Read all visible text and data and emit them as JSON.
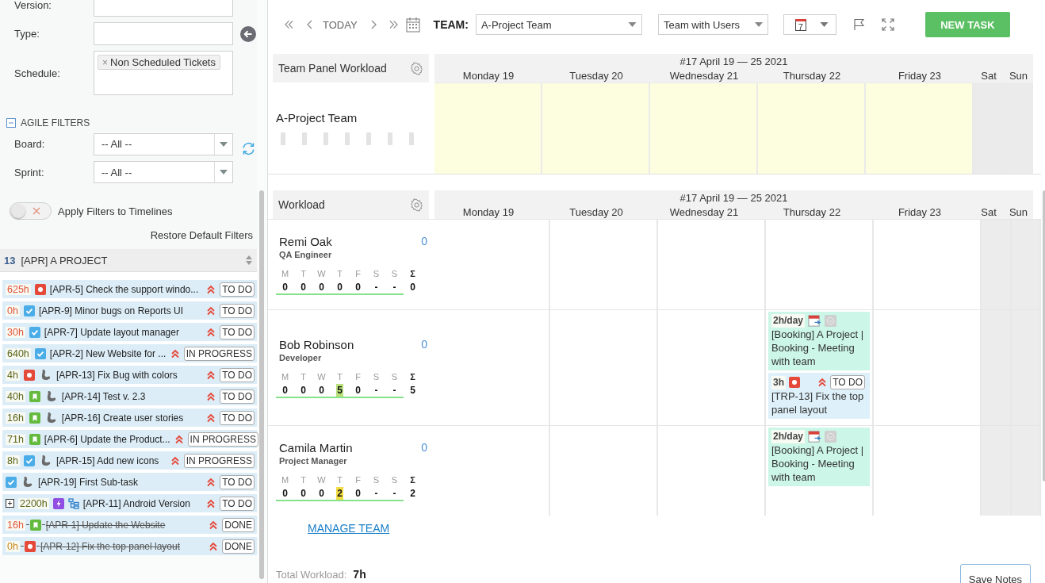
{
  "filters": {
    "fields": [
      {
        "label": "Version:",
        "kind": "text"
      },
      {
        "label": "Type:",
        "kind": "text"
      },
      {
        "label": "Schedule:",
        "kind": "tags",
        "tags": [
          {
            "remove": "×",
            "label": "Non Scheduled Tickets"
          }
        ]
      }
    ],
    "agile": {
      "title": "AGILE FILTERS",
      "expanded": true,
      "selects": [
        {
          "label": "Board:",
          "value": "-- All --"
        },
        {
          "label": "Sprint:",
          "value": "-- All --"
        }
      ]
    },
    "apply_toggle": {
      "label": "Apply Filters to Timelines",
      "on": false
    },
    "restore": "Restore Default Filters"
  },
  "project": {
    "count": "13",
    "name": "[APR] A PROJECT"
  },
  "tasks": [
    {
      "hours": "625h",
      "color": "#e2573a",
      "kind": "bug",
      "expandable": false,
      "assignee": false,
      "hierarchy": false,
      "title": "[APR-5] Check the support windo...",
      "status": "TO DO",
      "done": false
    },
    {
      "hours": "0h",
      "color": "#e2573a",
      "kind": "task",
      "expandable": false,
      "assignee": false,
      "hierarchy": false,
      "title": "[APR-9] Minor bugs on Reports UI",
      "status": "TO DO",
      "done": false
    },
    {
      "hours": "30h",
      "color": "#e2573a",
      "kind": "task",
      "expandable": false,
      "assignee": false,
      "hierarchy": false,
      "title": "[APR-7] Update layout manager",
      "status": "TO DO",
      "done": false
    },
    {
      "hours": "640h",
      "color": "#5c6418",
      "kind": "task",
      "expandable": false,
      "assignee": false,
      "hierarchy": false,
      "title": "[APR-2] New Website for ...",
      "status": "IN PROGRESS",
      "done": false
    },
    {
      "hours": "4h",
      "color": "#5c6418",
      "kind": "bug",
      "expandable": false,
      "assignee": true,
      "hierarchy": false,
      "title": "[APR-13] Fix Bug with colors",
      "status": "TO DO",
      "done": false
    },
    {
      "hours": "40h",
      "color": "#5c6418",
      "kind": "story",
      "expandable": false,
      "assignee": true,
      "hierarchy": false,
      "title": "[APR-14] Test v. 2.3",
      "status": "TO DO",
      "done": false
    },
    {
      "hours": "16h",
      "color": "#5c6418",
      "kind": "story",
      "expandable": false,
      "assignee": true,
      "hierarchy": false,
      "title": "[APR-16] Create user stories",
      "status": "TO DO",
      "done": false
    },
    {
      "hours": "71h",
      "color": "#5c6418",
      "kind": "story",
      "expandable": false,
      "assignee": false,
      "hierarchy": false,
      "title": "[APR-6] Update the Product...",
      "status": "IN PROGRESS",
      "done": false
    },
    {
      "hours": "8h",
      "color": "#5c6418",
      "kind": "task",
      "expandable": false,
      "assignee": true,
      "hierarchy": false,
      "title": "[APR-15] Add new icons",
      "status": "IN PROGRESS",
      "done": false
    },
    {
      "kind": "task",
      "expandable": false,
      "assignee": true,
      "hierarchy": false,
      "title": "[APR-19] First Sub-task",
      "status": "TO DO",
      "done": false
    },
    {
      "hours": "2200h",
      "color": "#5c6418",
      "kind": "epic",
      "expandable": true,
      "assignee": false,
      "hierarchy": true,
      "title": "[APR-11] Android Version",
      "status": "TO DO",
      "done": false
    },
    {
      "hours": "16h",
      "color": "#e2573a",
      "kind": "story",
      "expandable": false,
      "assignee": false,
      "hierarchy": false,
      "title": "[APR-1] Update the Website",
      "status": "DONE",
      "done": true
    },
    {
      "hours": "0h",
      "color": "#c98a1e",
      "kind": "bug",
      "expandable": false,
      "assignee": false,
      "hierarchy": false,
      "title": "[APR-12] Fix the top panel layout",
      "status": "DONE",
      "done": true
    }
  ],
  "toolbar": {
    "today": "TODAY",
    "team_label": "TEAM:",
    "team": "A-Project Team",
    "view": "Team with Users",
    "date_day": "7",
    "new_task": "NEW TASK"
  },
  "team_panel": {
    "title": "Team Panel Workload",
    "week": "#17 April 19 — 25 2021",
    "team": "A-Project Team",
    "days": [
      {
        "label": "Monday 19",
        "weekend": false
      },
      {
        "label": "Tuesday 20",
        "weekend": false
      },
      {
        "label": "Wednesday 21",
        "weekend": false
      },
      {
        "label": "Thursday 22",
        "weekend": false
      },
      {
        "label": "Friday 23",
        "weekend": false
      },
      {
        "label": "Sat",
        "weekend": true
      },
      {
        "label": "Sun",
        "weekend": true
      }
    ]
  },
  "workload": {
    "title": "Workload",
    "week": "#17 April 19 — 25 2021",
    "days": [
      "Monday 19",
      "Tuesday 20",
      "Wednesday 21",
      "Thursday 22",
      "Friday 23",
      "Sat",
      "Sun"
    ],
    "people": [
      {
        "name": "Remi Oak",
        "role": "QA Engineer",
        "count": "0",
        "total_label": "Σ",
        "total": "0",
        "days": [
          {
            "letter": "M",
            "value": "0"
          },
          {
            "letter": "T",
            "value": "0"
          },
          {
            "letter": "W",
            "value": "0"
          },
          {
            "letter": "T",
            "value": "0"
          },
          {
            "letter": "F",
            "value": "0"
          },
          {
            "letter": "S",
            "value": "-"
          },
          {
            "letter": "S",
            "value": "-"
          }
        ],
        "cells": [
          {
            "weekend": false
          },
          {
            "weekend": false
          },
          {
            "weekend": false
          },
          {
            "weekend": false
          },
          {
            "weekend": false
          },
          {
            "weekend": true
          },
          {
            "weekend": true
          }
        ]
      },
      {
        "name": "Bob Robinson",
        "role": "Developer",
        "count": "0",
        "total_label": "Σ",
        "total": "5",
        "days": [
          {
            "letter": "M",
            "value": "0"
          },
          {
            "letter": "T",
            "value": "0"
          },
          {
            "letter": "W",
            "value": "0"
          },
          {
            "letter": "T",
            "value": "5",
            "color": "#b9e07a"
          },
          {
            "letter": "F",
            "value": "0"
          },
          {
            "letter": "S",
            "value": "-"
          },
          {
            "letter": "S",
            "value": "-"
          }
        ],
        "cells": [
          {
            "weekend": false
          },
          {
            "weekend": false
          },
          {
            "weekend": false
          },
          {
            "weekend": false,
            "cards": [
              {
                "kind": "booking",
                "rate": "2h/day",
                "title": "[Booking] A Project | Booking - Meeting with team"
              },
              {
                "kind": "task",
                "hours": "3h",
                "issue": {
                  "kind": "bug"
                },
                "status": "TO DO",
                "title": "[TRP-13] Fix the top panel layout"
              }
            ]
          },
          {
            "weekend": false
          },
          {
            "weekend": true
          },
          {
            "weekend": true
          }
        ]
      },
      {
        "name": "Camila Martin",
        "role": "Project Manager",
        "count": "0",
        "total_label": "Σ",
        "total": "2",
        "days": [
          {
            "letter": "M",
            "value": "0"
          },
          {
            "letter": "T",
            "value": "0"
          },
          {
            "letter": "W",
            "value": "0"
          },
          {
            "letter": "T",
            "value": "2",
            "color": "#f3dd45"
          },
          {
            "letter": "F",
            "value": "0"
          },
          {
            "letter": "S",
            "value": "-"
          },
          {
            "letter": "S",
            "value": "-"
          }
        ],
        "cells": [
          {
            "weekend": false
          },
          {
            "weekend": false
          },
          {
            "weekend": false
          },
          {
            "weekend": false,
            "cards": [
              {
                "kind": "booking",
                "rate": "2h/day",
                "title": "[Booking] A Project | Booking - Meeting with team"
              }
            ]
          },
          {
            "weekend": false
          },
          {
            "weekend": true
          },
          {
            "weekend": true
          }
        ]
      }
    ]
  },
  "manage": "MANAGE TEAM",
  "total_label": "Total Workload:",
  "total": "7h",
  "save": "Save Notes"
}
